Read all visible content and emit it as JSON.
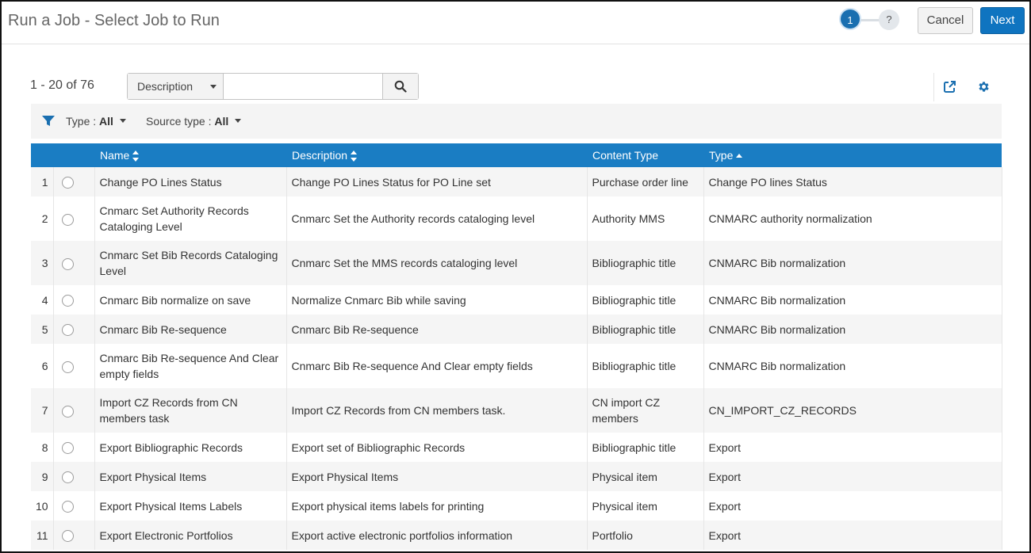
{
  "header": {
    "title": "Run a Job - Select Job to Run",
    "steps": [
      {
        "label": "1",
        "active": true
      },
      {
        "label": "?",
        "active": false
      }
    ],
    "cancel_label": "Cancel",
    "next_label": "Next"
  },
  "toolbar": {
    "count": "1 - 20 of 76",
    "search_field": "Description",
    "search_value": "",
    "search_icon": "search-icon",
    "export_icon": "export-icon",
    "settings_icon": "gear-icon"
  },
  "filters": {
    "type_label": "Type :",
    "type_value": "All",
    "source_label": "Source type :",
    "source_value": "All"
  },
  "table": {
    "headers": [
      "Name",
      "Description",
      "Content Type",
      "Type"
    ],
    "rows": [
      {
        "num": "1",
        "name": "Change PO Lines Status",
        "description": "Change PO Lines Status for PO Line set",
        "content_type": "Purchase order line",
        "type": "Change PO lines Status"
      },
      {
        "num": "2",
        "name": "Cnmarc Set Authority Records Cataloging Level",
        "description": "Cnmarc Set the Authority records cataloging level",
        "content_type": "Authority MMS",
        "type": "CNMARC authority normalization"
      },
      {
        "num": "3",
        "name": "Cnmarc Set Bib Records Cataloging Level",
        "description": "Cnmarc Set the MMS records cataloging level",
        "content_type": "Bibliographic title",
        "type": "CNMARC Bib normalization"
      },
      {
        "num": "4",
        "name": "Cnmarc Bib normalize on save",
        "description": "Normalize Cnmarc Bib while saving",
        "content_type": "Bibliographic title",
        "type": "CNMARC Bib normalization"
      },
      {
        "num": "5",
        "name": "Cnmarc Bib Re-sequence",
        "description": "Cnmarc Bib Re-sequence",
        "content_type": "Bibliographic title",
        "type": "CNMARC Bib normalization"
      },
      {
        "num": "6",
        "name": "Cnmarc Bib Re-sequence And Clear empty fields",
        "description": "Cnmarc Bib Re-sequence And Clear empty fields",
        "content_type": "Bibliographic title",
        "type": "CNMARC Bib normalization"
      },
      {
        "num": "7",
        "name": "Import CZ Records from CN members task",
        "description": "Import CZ Records from CN members task.",
        "content_type": "CN import CZ members",
        "type": "CN_IMPORT_CZ_RECORDS"
      },
      {
        "num": "8",
        "name": "Export Bibliographic Records",
        "description": "Export set of Bibliographic Records",
        "content_type": "Bibliographic title",
        "type": "Export"
      },
      {
        "num": "9",
        "name": "Export Physical Items",
        "description": "Export Physical Items",
        "content_type": "Physical item",
        "type": "Export"
      },
      {
        "num": "10",
        "name": "Export Physical Items Labels",
        "description": "Export physical items labels for printing",
        "content_type": "Physical item",
        "type": "Export"
      },
      {
        "num": "11",
        "name": "Export Electronic Portfolios",
        "description": "Export active electronic portfolios information",
        "content_type": "Portfolio",
        "type": "Export"
      }
    ]
  },
  "colors": {
    "accent": "#1a7dc3",
    "primary_button": "#0f74c0"
  }
}
